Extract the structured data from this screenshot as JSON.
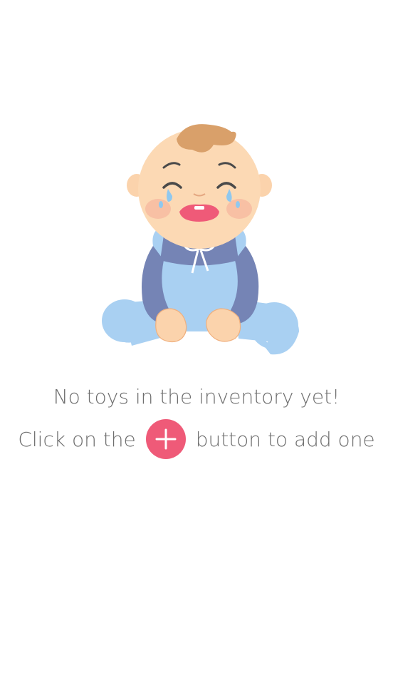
{
  "empty_state": {
    "illustration_icon": "crying-baby-icon",
    "headline": "No toys in the inventory yet!",
    "hint_prefix": "Click on the",
    "hint_suffix": "button to add one",
    "add_icon": "plus-icon"
  },
  "colors": {
    "text": "#6e6e6e",
    "accent": "#ef5a78",
    "background": "#ffffff"
  }
}
